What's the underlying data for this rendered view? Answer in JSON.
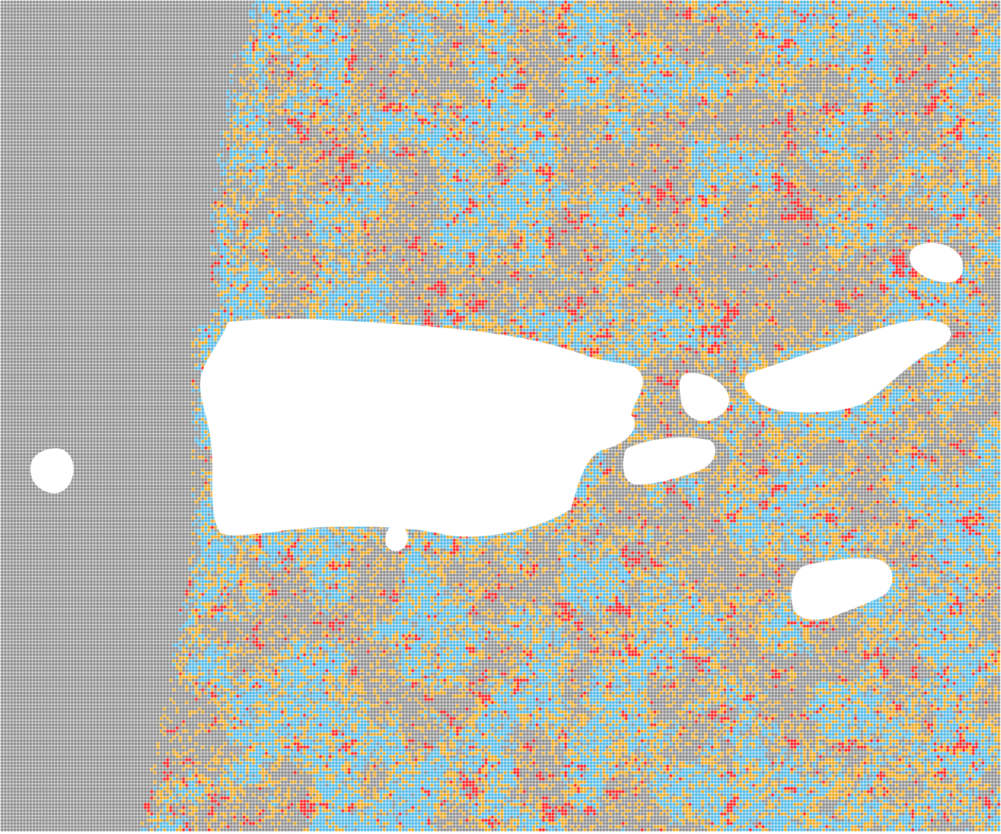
{
  "map": {
    "type": "point-grid",
    "background": "#ffffff",
    "categories": [
      {
        "key": "base",
        "color": "#8a8a8a"
      },
      {
        "key": "blue",
        "color": "#4db8e8"
      },
      {
        "key": "orange",
        "color": "#f0a81c"
      },
      {
        "key": "red",
        "color": "#ff1a1a"
      }
    ],
    "masked_areas": [
      {
        "shape": "main-island"
      },
      {
        "shape": "west-islet"
      },
      {
        "shape": "south-islet"
      },
      {
        "shape": "small-island-center"
      },
      {
        "shape": "small-island-east"
      },
      {
        "shape": "long-island-east"
      },
      {
        "shape": "island-northeast"
      },
      {
        "shape": "island-southeast"
      }
    ]
  }
}
